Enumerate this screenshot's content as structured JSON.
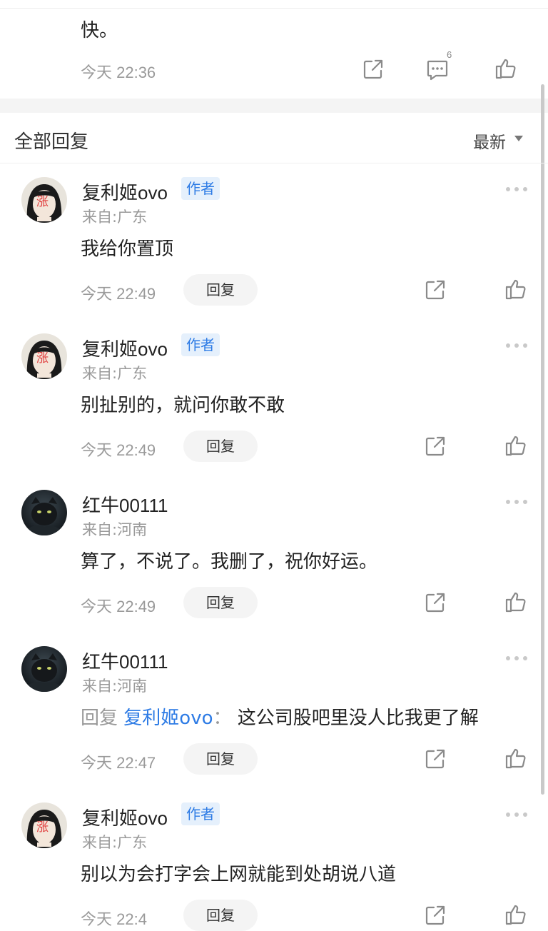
{
  "previous_comment": {
    "text": "快。",
    "time": "今天 22:36",
    "comment_count": "6",
    "icons": [
      "share-icon",
      "comment-icon",
      "like-icon"
    ]
  },
  "replies_section": {
    "title": "全部回复",
    "sort_label": "最新"
  },
  "replies": [
    {
      "name": "复利姬ovo",
      "badge": "作者",
      "location": "来自:广东",
      "content": "我给你置顶",
      "time": "今天 22:49",
      "reply_label": "回复",
      "avatar": "avatar-girl"
    },
    {
      "name": "复利姬ovo",
      "badge": "作者",
      "location": "来自:广东",
      "content": "别扯别的，就问你敢不敢",
      "time": "今天 22:49",
      "reply_label": "回复",
      "avatar": "avatar-girl"
    },
    {
      "name": "红牛00111",
      "location": "来自:河南",
      "content": "算了，不说了。我删了，祝你好运。",
      "time": "今天 22:49",
      "reply_label": "回复",
      "avatar": "avatar-panther"
    },
    {
      "name": "红牛00111",
      "location": "来自:河南",
      "reply_prefix": "回复",
      "reply_to": "复利姬ovo",
      "reply_colon": "：",
      "content": "这公司股吧里没人比我更了解",
      "time": "今天 22:47",
      "reply_label": "回复",
      "avatar": "avatar-panther"
    },
    {
      "name": "复利姬ovo",
      "badge": "作者",
      "location": "来自:广东",
      "content": "别以为会打字会上网就能到处胡说八道",
      "time": "今天 22:4",
      "reply_label": "回复",
      "avatar": "avatar-girl"
    }
  ],
  "avatar_stamp": "涨",
  "colors": {
    "accent": "#2d7be5",
    "badge_bg": "#e5f0fc",
    "muted": "#9a9a9a"
  }
}
